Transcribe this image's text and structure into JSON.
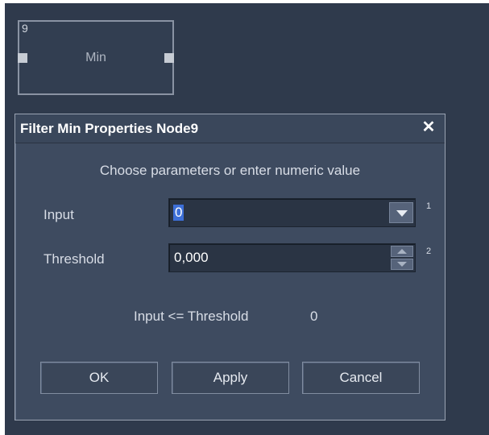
{
  "node": {
    "id": "9",
    "label": "Min"
  },
  "dialog": {
    "title": "Filter Min Properties Node9",
    "close_glyph": "✕",
    "subtitle": "Choose parameters or enter numeric value",
    "fields": [
      {
        "label": "Input",
        "value": "0",
        "pin": "1",
        "control": "dropdown"
      },
      {
        "label": "Threshold",
        "value": "0,000",
        "pin": "2",
        "control": "spinner"
      }
    ],
    "expression": {
      "text": "Input <= Threshold",
      "result": "0"
    },
    "buttons": {
      "ok": "OK",
      "apply": "Apply",
      "cancel": "Cancel"
    }
  },
  "colors": {
    "canvas": "#2f3a4c",
    "dialog": "#3e4b60",
    "selection": "#3d6fd8"
  }
}
